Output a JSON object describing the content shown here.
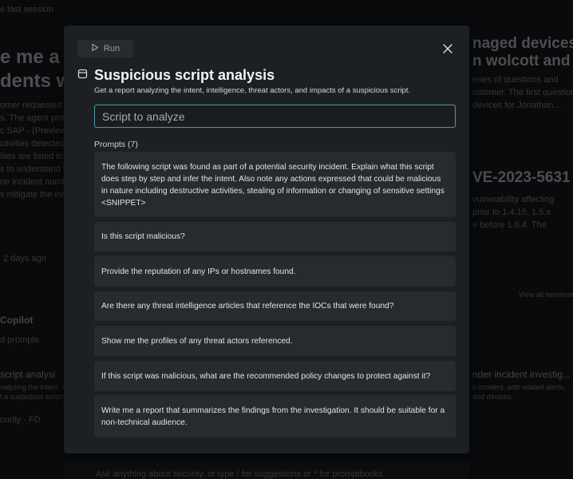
{
  "background": {
    "top_left": "e last session",
    "left_heading_1": "e me a p",
    "left_heading_2": "dents w",
    "left_lines": [
      "omer requested a",
      "s. The agent provi",
      "c SAP - (Preview)",
      "ctivities detected f",
      "ities are listed in t",
      "s to understand th",
      "ne incident numb",
      "s mitigate the inci"
    ],
    "left_time": "2 days ago",
    "left_section": "Copilot",
    "left_chip": "d prompts",
    "left_card_title": "script analysi",
    "left_card_lines": [
      "nalyzing the intent, i",
      "f a suspicious script"
    ],
    "left_bottom": "curity - FD",
    "right_heading_1": "naged devices",
    "right_heading_2": "n wolcott and",
    "right_lines": [
      "eries of questions and",
      "ustomer. The first question",
      "devices for Jonathan..."
    ],
    "right_cve": "VE-2023-5631",
    "right_cve_lines": [
      "vulnerability affecting",
      "prior to 1.4.15, 1.5.x",
      "e before 1.6.4. The"
    ],
    "right_view_all": "View all sessions",
    "right_card_title": "nder incident investig...",
    "right_card_lines": [
      "n incident, with related alerts,",
      "and devices."
    ],
    "bottom_prompt": "Ask anything about security, or type / for suggestions or * for promptbooks"
  },
  "modal": {
    "run_label": "Run",
    "title": "Suspicious script analysis",
    "subtitle": "Get a report analyzing the intent, intelligence, threat actors, and impacts of a suspicious script.",
    "input_placeholder": "Script to analyze",
    "prompts_label": "Prompts (7)",
    "prompts": [
      "The following script was found as part of a potential security incident. Explain what this script does step by step and infer the intent. Also note any actions expressed that could be malicious in nature including destructive activities, stealing of information or changing of sensitive settings <SNIPPET>",
      "Is this script malicious?",
      "Provide the reputation of any IPs or hostnames found.",
      "Are there any threat intelligence articles that reference the IOCs that were found?",
      "Show me the profiles of any threat actors referenced.",
      "If this script was malicious, what are the recommended policy changes to protect against it?",
      "Write me a report that summarizes the findings from the investigation. It should be suitable for a non-technical audience."
    ]
  },
  "colors": {
    "modal_bg": "#1d2023",
    "card_bg": "#272a2e",
    "accent": "#4c9aa6"
  },
  "icons": {
    "run": "play-icon",
    "close": "close-icon",
    "title": "promptbook-icon"
  }
}
